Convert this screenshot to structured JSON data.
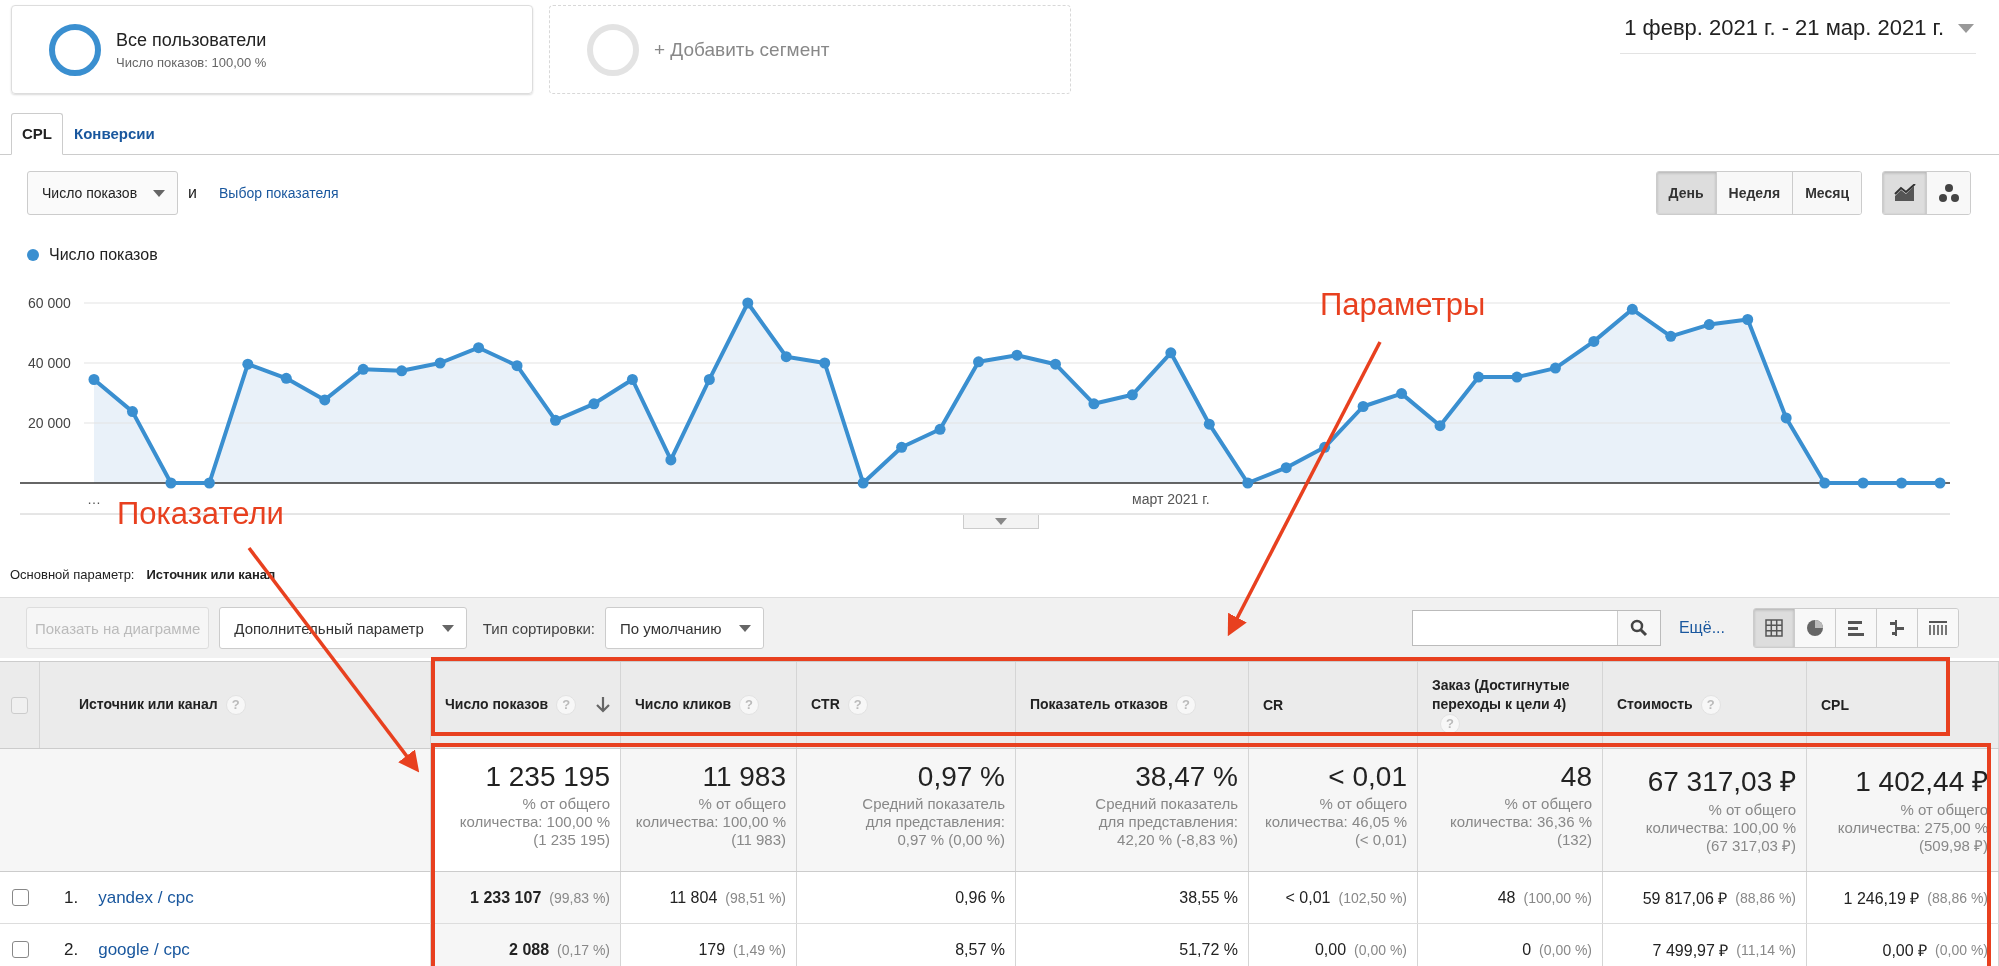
{
  "segments": [
    {
      "kind": "active",
      "title": "Все пользователи",
      "subtitle": "Число показов: 100,00 %"
    },
    {
      "kind": "add",
      "title": "+ Добавить сегмент"
    }
  ],
  "date_range": "1 февр. 2021 г. - 21 мар. 2021 г.",
  "tabs": [
    {
      "label": "CPL",
      "selected": true
    },
    {
      "label": "Конверсии",
      "selected": false
    }
  ],
  "metric_select": "Число показов",
  "conjunction": "и",
  "metric_link": "Выбор показателя",
  "period_buttons": [
    {
      "label": "День",
      "selected": true
    },
    {
      "label": "Неделя",
      "selected": false
    },
    {
      "label": "Месяц",
      "selected": false
    }
  ],
  "chart_type_buttons": [
    {
      "kind": "line",
      "selected": true
    },
    {
      "kind": "motion",
      "selected": false
    }
  ],
  "chart": {
    "chart_data": {
      "type": "area",
      "categories": [
        "…",
        null,
        null,
        null,
        null,
        null,
        null,
        null,
        null,
        null,
        null,
        null,
        null,
        null,
        null,
        null,
        null,
        null,
        null,
        null,
        null,
        null,
        null,
        null,
        null,
        null,
        null,
        null,
        "март 2021 г.",
        null,
        null,
        null,
        null,
        null,
        null,
        null,
        null,
        null,
        null,
        null,
        null,
        null,
        null,
        null,
        null,
        null,
        null,
        null,
        null
      ],
      "series": [
        {
          "name": "Число показов",
          "color": "#3a8fd0",
          "values": [
            34500,
            23800,
            0,
            0,
            39600,
            34900,
            27700,
            37900,
            37400,
            40000,
            45100,
            39100,
            20900,
            26400,
            34500,
            7700,
            34500,
            60000,
            42100,
            40000,
            0,
            11900,
            17900,
            40400,
            42600,
            39600,
            26400,
            29400,
            43400,
            19600,
            0,
            5100,
            11900,
            25500,
            29800,
            19100,
            35300,
            35300,
            38300,
            47200,
            57900,
            48900,
            52800,
            54500,
            21700,
            0,
            0,
            0,
            0
          ]
        }
      ],
      "ylim": [
        0,
        60000
      ],
      "grid": true,
      "yticks": [
        {
          "value": 20000,
          "label": "20 000"
        },
        {
          "value": 40000,
          "label": "40 000"
        },
        {
          "value": 60000,
          "label": "60 000"
        }
      ]
    }
  },
  "primary_dimension": {
    "label": "Основной параметр:",
    "value": "Источник или канал"
  },
  "toolbar": {
    "plot_button": {
      "label": "Показать на диаграмме",
      "disabled": true
    },
    "secondary_dimension": "Дополнительный параметр",
    "sort_label": "Тип сортировки:",
    "sort_value": "По умолчанию",
    "more_link": "Ещё...",
    "view_buttons": [
      {
        "kind": "table",
        "selected": true
      },
      {
        "kind": "pie",
        "selected": false
      },
      {
        "kind": "bars",
        "selected": false
      },
      {
        "kind": "comparison",
        "selected": false
      },
      {
        "kind": "pivot",
        "selected": false
      }
    ]
  },
  "table": {
    "select_all_checked": false,
    "dimension_column": {
      "label": "Источник или канал",
      "help": "?"
    },
    "columns": [
      {
        "label": "Число показов",
        "help": "?",
        "sorted": true
      },
      {
        "label": "Число кликов",
        "help": "?",
        "sorted": false
      },
      {
        "label": "CTR",
        "help": "?",
        "sorted": false
      },
      {
        "label": "Показатель отказов",
        "help": "?",
        "sorted": false
      },
      {
        "label": "CR",
        "sorted": false
      },
      {
        "label": "Заказ (Достигнутые переходы к цели 4)",
        "help": "?",
        "sorted": false
      },
      {
        "label": "Стоимость",
        "help": "?",
        "sorted": false
      },
      {
        "label": "CPL",
        "sorted": false
      }
    ],
    "totals": [
      {
        "value": "1 235 195",
        "note": "% от общего количества: 100,00 % (1 235 195)"
      },
      {
        "value": "11 983",
        "note": "% от общего количества: 100,00 % (11 983)"
      },
      {
        "value": "0,97 %",
        "note": "Средний показатель для представления: 0,97 % (0,00 %)"
      },
      {
        "value": "38,47 %",
        "note": "Средний показатель для представления: 42,20 % (-8,83 %)"
      },
      {
        "value": "< 0,01",
        "note": "% от общего количества: 46,05 % (< 0,01)"
      },
      {
        "value": "48",
        "note": "% от общего количества: 36,36 % (132)"
      },
      {
        "value": "67 317,03 ₽",
        "note": "% от общего количества: 100,00 % (67 317,03 ₽)"
      },
      {
        "value": "1 402,44 ₽",
        "note": "% от общего количества: 275,00 % (509,98 ₽)"
      }
    ],
    "rows": [
      {
        "index": "1.",
        "name": "yandex / cpc",
        "checked": false,
        "cells": [
          {
            "value": "1 233 107",
            "share": "(99,83 %)"
          },
          {
            "value": "11 804",
            "share": "(98,51 %)"
          },
          {
            "value": "0,96 %"
          },
          {
            "value": "38,55 %"
          },
          {
            "value": "< 0,01",
            "share": "(102,50 %)"
          },
          {
            "value": "48",
            "share": "(100,00 %)"
          },
          {
            "value": "59 817,06 ₽",
            "share": "(88,86 %)"
          },
          {
            "value": "1 246,19 ₽",
            "share": "(88,86 %)"
          }
        ]
      },
      {
        "index": "2.",
        "name": "google / cpc",
        "checked": false,
        "cells": [
          {
            "value": "2 088",
            "share": "(0,17 %)"
          },
          {
            "value": "179",
            "share": "(1,49 %)"
          },
          {
            "value": "8,57 %"
          },
          {
            "value": "51,72 %"
          },
          {
            "value": "0,00",
            "share": "(0,00 %)"
          },
          {
            "value": "0",
            "share": "(0,00 %)"
          },
          {
            "value": "7 499,97 ₽",
            "share": "(11,14 %)"
          },
          {
            "value": "0,00 ₽",
            "share": "(0,00 %)"
          }
        ]
      }
    ]
  },
  "annotations": [
    {
      "label": "Показатели"
    },
    {
      "label": "Параметры"
    }
  ]
}
